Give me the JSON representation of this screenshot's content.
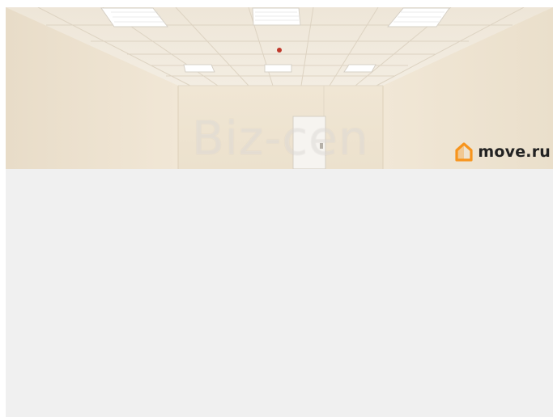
{
  "photo": {
    "watermark_text": "Biz-cen",
    "logo": {
      "icon": "house-icon",
      "text": "move.ru",
      "accent_color": "#f7941d"
    }
  },
  "colors": {
    "wall": "#efe4d2",
    "ceiling": "#f2ece1",
    "page_background": "#f0f0f0"
  }
}
